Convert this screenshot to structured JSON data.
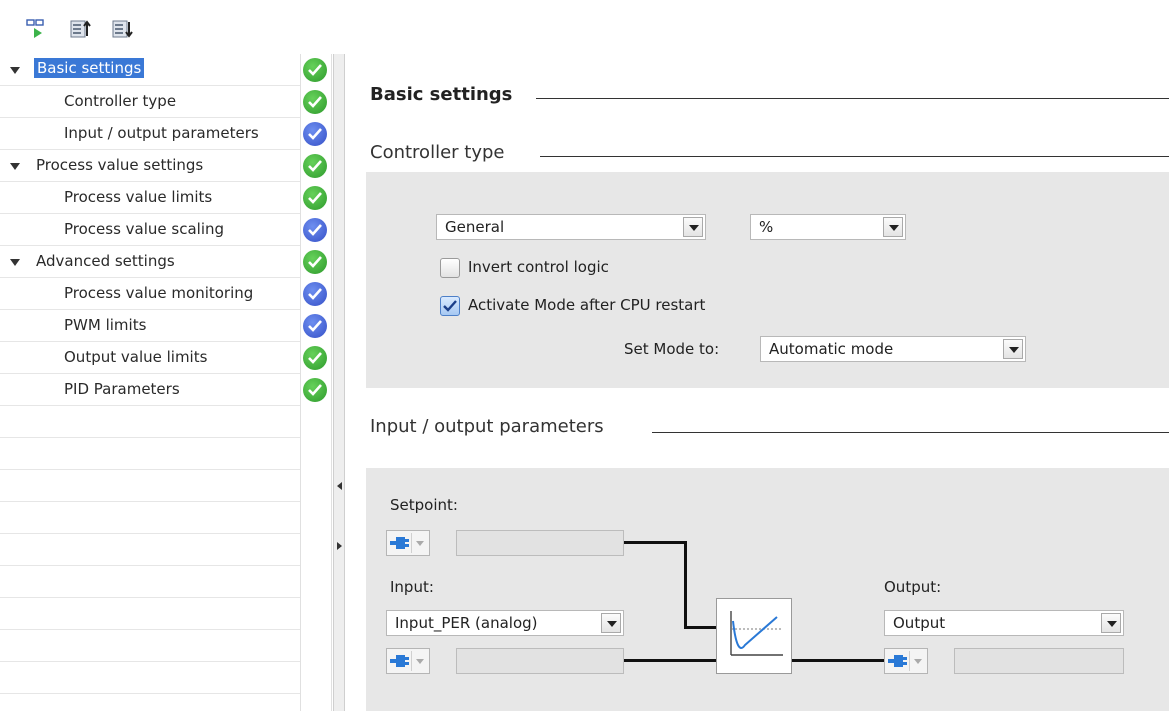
{
  "toolbar": {
    "buttons": [
      {
        "icon": "view-toggle-icon"
      },
      {
        "icon": "upload-params-icon"
      },
      {
        "icon": "download-params-icon"
      }
    ]
  },
  "tree": {
    "items": [
      {
        "label": "Basic settings",
        "level": 0,
        "expanded": true,
        "selected": true,
        "status": "green"
      },
      {
        "label": "Controller type",
        "level": 1,
        "status": "green"
      },
      {
        "label": "Input / output parameters",
        "level": 1,
        "status": "blue"
      },
      {
        "label": "Process value settings",
        "level": 0,
        "expanded": true,
        "status": "green"
      },
      {
        "label": "Process value limits",
        "level": 1,
        "status": "green"
      },
      {
        "label": "Process value scaling",
        "level": 1,
        "status": "blue"
      },
      {
        "label": "Advanced settings",
        "level": 0,
        "expanded": true,
        "status": "green"
      },
      {
        "label": "Process value monitoring",
        "level": 1,
        "status": "blue"
      },
      {
        "label": "PWM limits",
        "level": 1,
        "status": "blue"
      },
      {
        "label": "Output value limits",
        "level": 1,
        "status": "green"
      },
      {
        "label": "PID Parameters",
        "level": 1,
        "status": "green"
      }
    ]
  },
  "main": {
    "basic_settings_title": "Basic settings",
    "controller_type_title": "Controller type",
    "controller_type": {
      "type_value": "General",
      "unit_value": "%",
      "invert_label": "Invert control logic",
      "invert_checked": false,
      "activate_label": "Activate Mode after CPU restart",
      "activate_checked": true,
      "set_mode_label": "Set Mode to:",
      "set_mode_value": "Automatic mode"
    },
    "io_title": "Input / output parameters",
    "io": {
      "setpoint_label": "Setpoint:",
      "setpoint_value": "",
      "input_label": "Input:",
      "input_select": "Input_PER (analog)",
      "input_value": "",
      "output_label": "Output:",
      "output_select": "Output",
      "output_value": ""
    }
  },
  "colors": {
    "selection": "#3a78d6",
    "status_green": "#2e9a2c",
    "status_blue": "#3550c7",
    "panel_bg": "#e7e7e7"
  }
}
